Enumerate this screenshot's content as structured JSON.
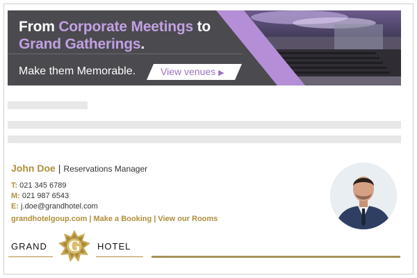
{
  "banner": {
    "headline_pre": "From ",
    "headline_accent1": "Corporate Meetings",
    "headline_mid": " to",
    "headline_accent2": "Grand Gatherings",
    "headline_post": ".",
    "tagline": "Make them Memorable.",
    "cta_label": "View venues",
    "cta_arrow": "▶",
    "accent_color": "#c3a0e3"
  },
  "signature": {
    "name": "John Doe",
    "separator": "|",
    "role": "Reservations Manager",
    "phone_label": "T:",
    "phone": "021 345 6789",
    "mobile_label": "M:",
    "mobile": "021 987 6543",
    "email_label": "E:",
    "email": "j.doe@grandhotel.com",
    "links": [
      {
        "label": "grandhotelgoup.com"
      },
      {
        "label": "Make a Booking"
      },
      {
        "label": "View our Rooms"
      }
    ],
    "link_separator": "|",
    "brand_color": "#b08e3a"
  },
  "logo": {
    "left_word": "GRAND",
    "emblem_letter": "G",
    "right_word": "HOTEL"
  }
}
